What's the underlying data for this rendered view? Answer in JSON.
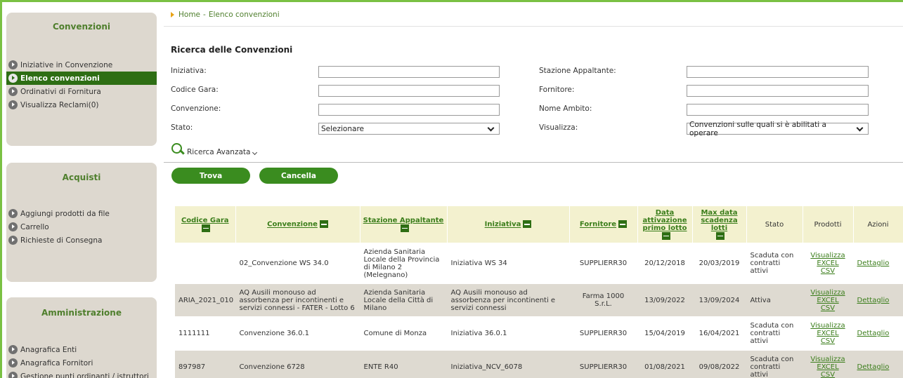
{
  "breadcrumb": {
    "home": "Home",
    "separator": "-",
    "current": "Elenco convenzioni"
  },
  "sidebar": {
    "convenzioni": {
      "title": "Convenzioni",
      "items": [
        {
          "label": "Iniziative in Convenzione",
          "active": false
        },
        {
          "label": "Elenco convenzioni",
          "active": true
        },
        {
          "label": "Ordinativi di Fornitura",
          "active": false
        },
        {
          "label": "Visualizza Reclami(0)",
          "active": false
        }
      ]
    },
    "acquisti": {
      "title": "Acquisti",
      "items": [
        {
          "label": "Aggiungi prodotti da file"
        },
        {
          "label": "Carrello"
        },
        {
          "label": "Richieste di Consegna"
        }
      ]
    },
    "amministrazione": {
      "title": "Amministrazione",
      "items": [
        {
          "label": "Anagrafica Enti"
        },
        {
          "label": "Anagrafica Fornitori"
        },
        {
          "label": "Gestione punti ordinanti / istruttori"
        }
      ]
    }
  },
  "search": {
    "title": "Ricerca delle Convenzioni",
    "iniziativa": {
      "label": "Iniziativa:",
      "value": ""
    },
    "codice_gara": {
      "label": "Codice Gara:",
      "value": ""
    },
    "convenzione": {
      "label": "Convenzione:",
      "value": ""
    },
    "stato": {
      "label": "Stato:",
      "value": "Selezionare"
    },
    "stazione_appaltante": {
      "label": "Stazione Appaltante:",
      "value": ""
    },
    "fornitore": {
      "label": "Fornitore:",
      "value": ""
    },
    "nome_ambito": {
      "label": "Nome Ambito:",
      "value": ""
    },
    "visualizza": {
      "label": "Visualizza:",
      "value": "Convenzioni sulle quali si è abilitati a operare"
    },
    "advanced": "Ricerca Avanzata",
    "find_button": "Trova",
    "cancel_button": "Cancella"
  },
  "table": {
    "headers": {
      "codice_gara": "Codice Gara",
      "convenzione": "Convenzione",
      "stazione": "Stazione Appaltante",
      "iniziativa": "Iniziativa",
      "fornitore": "Fornitore",
      "data_attivazione": "Data attivazione primo lotto",
      "max_data": "Max data scadenza lotti",
      "stato": "Stato",
      "prodotti": "Prodotti",
      "azioni": "Azioni"
    },
    "rows": [
      {
        "codice": "",
        "convenzione": "02_Convenzione WS 34.0",
        "stazione": "Azienda Sanitaria Locale della Provincia di Milano 2 (Melegnano)",
        "iniziativa": "Iniziativa WS 34",
        "fornitore": "SUPPLIERR30",
        "data_attivazione": "20/12/2018",
        "max_data": "20/03/2019",
        "stato": "Scaduta con contratti attivi",
        "p1": "Visualizza",
        "p2": "EXCEL",
        "p3": "CSV",
        "azione": "Dettaglio"
      },
      {
        "codice": "ARIA_2021_010",
        "convenzione": "AQ Ausili monouso ad assorbenza per incontinenti e servizi connessi - FATER - Lotto 6",
        "stazione": "Azienda Sanitaria Locale della Città di Milano",
        "iniziativa": "AQ Ausili monouso ad assorbenza per incontinenti e servizi connessi",
        "fornitore": "Farma 1000 S.r.L.",
        "data_attivazione": "13/09/2022",
        "max_data": "13/09/2024",
        "stato": "Attiva",
        "p1": "Visualizza",
        "p2": "EXCEL",
        "p3": "CSV",
        "azione": "Dettaglio"
      },
      {
        "codice": "1111111",
        "convenzione": "Convenzione 36.0.1",
        "stazione": "Comune di Monza",
        "iniziativa": "Iniziativa 36.0.1",
        "fornitore": "SUPPLIERR30",
        "data_attivazione": "15/04/2019",
        "max_data": "16/04/2021",
        "stato": "Scaduta con contratti attivi",
        "p1": "Visualizza",
        "p2": "EXCEL",
        "p3": "CSV",
        "azione": "Dettaglio"
      },
      {
        "codice": "897987",
        "convenzione": "Convenzione 6728",
        "stazione": "ENTE R40",
        "iniziativa": "Iniziativa_NCV_6078",
        "fornitore": "SUPPLIERR30",
        "data_attivazione": "01/08/2021",
        "max_data": "09/08/2022",
        "stato": "Scaduta con contratti attivi",
        "p1": "Visualizza",
        "p2": "EXCEL",
        "p3": "CSV",
        "azione": "Dettaglio"
      }
    ]
  },
  "colors": {
    "brand_green": "#3a8c1f",
    "active_green": "#2e6e14",
    "header_bg": "#f3f1cf",
    "panel_bg": "#ddd8cf",
    "frame": "#7ac143"
  }
}
